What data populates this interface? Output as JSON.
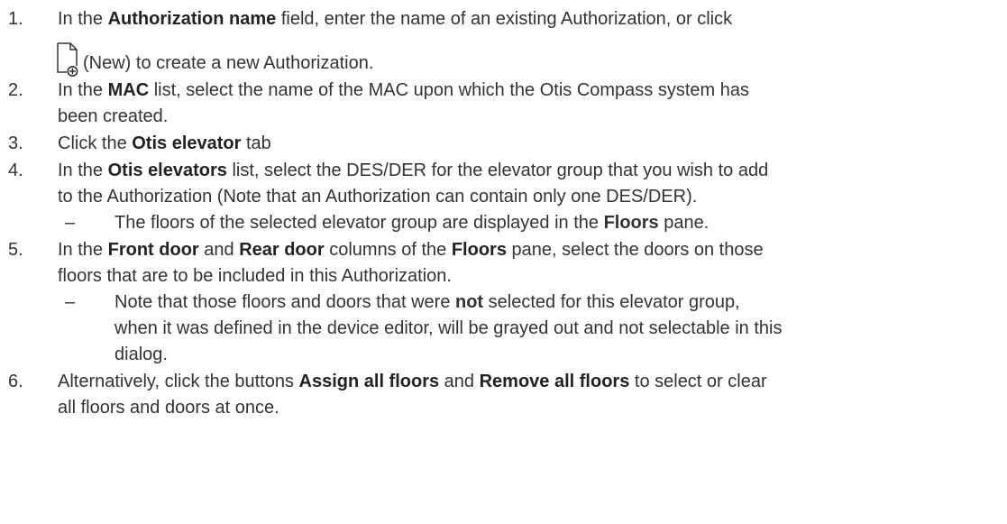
{
  "steps": [
    {
      "num": "1.",
      "p1": "In the ",
      "b1": "Authorization name",
      "p2": " field, enter the name of an existing Authorization, or click",
      "icon": "new-document-icon",
      "icon_text": "(New) to create a new Authorization."
    },
    {
      "num": "2.",
      "p1": "In the ",
      "b1": "MAC",
      "p2": " list, select the name of the MAC upon which the Otis Compass system has",
      "p3": "been created."
    },
    {
      "num": "3.",
      "p1": "Click the ",
      "b1": "Otis elevator",
      "p2": " tab"
    },
    {
      "num": "4.",
      "p1": "In the ",
      "b1": "Otis elevators",
      "p2": " list, select the DES/DER for the elevator group that you wish to add",
      "p3": "to the Authorization (Note that an Authorization can contain only one DES/DER).",
      "sub": {
        "dash": "–",
        "p1": "The floors of the selected elevator group are displayed in the ",
        "b1": "Floors",
        "p2": " pane."
      }
    },
    {
      "num": "5.",
      "p1": "In the ",
      "b1": "Front door",
      "p2": " and ",
      "b2": "Rear door",
      "p3": " columns of the ",
      "b3": "Floors",
      "p4": " pane, select the doors on those",
      "p5": "floors that are to be included in this Authorization.",
      "sub": {
        "dash": "–",
        "p1": "Note that those floors and doors that were ",
        "b1": "not",
        "p2": " selected for this elevator group,",
        "p3": "when it was defined in the device editor, will be grayed out and not selectable in this",
        "p4": "dialog."
      }
    },
    {
      "num": "6.",
      "p1": "Alternatively, click the buttons ",
      "b1": "Assign all floors",
      "p2": " and ",
      "b2": "Remove all floors",
      "p3": " to select or clear",
      "p4": "all floors and doors at once."
    }
  ]
}
